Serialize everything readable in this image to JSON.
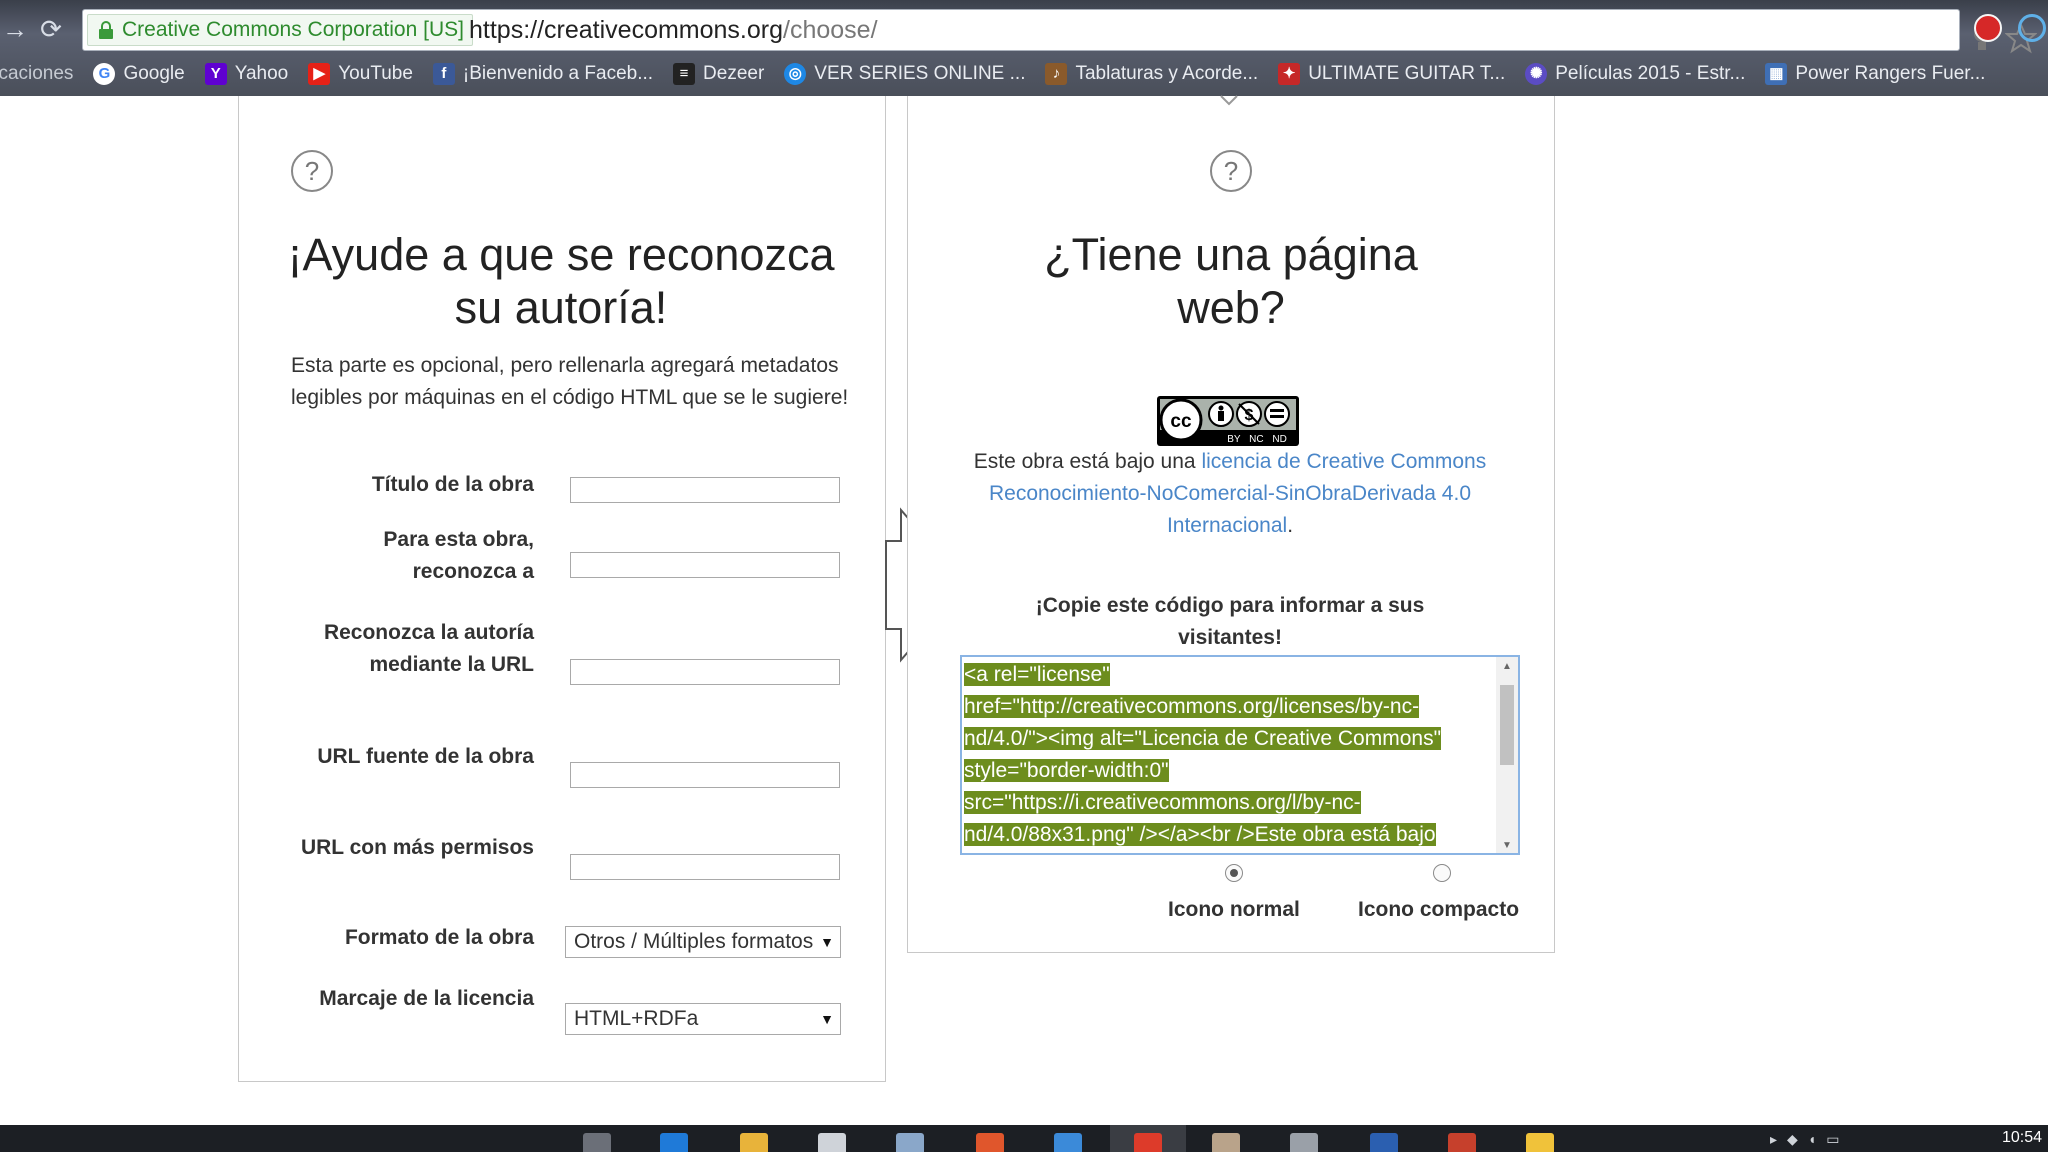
{
  "browser": {
    "secure_label": "Creative Commons Corporation [US]",
    "url_host": "https://creativecommons.org",
    "url_path": "/choose/",
    "bookmarks": [
      {
        "label": "licaciones",
        "icon": "apps-icon"
      },
      {
        "label": "Google",
        "icon": "google-icon"
      },
      {
        "label": "Yahoo",
        "icon": "yahoo-icon"
      },
      {
        "label": "YouTube",
        "icon": "youtube-icon"
      },
      {
        "label": "¡Bienvenido a Faceb...",
        "icon": "facebook-icon"
      },
      {
        "label": "Dezeer",
        "icon": "deezer-icon"
      },
      {
        "label": "VER SERIES ONLINE ...",
        "icon": "series-icon"
      },
      {
        "label": "Tablaturas y Acorde...",
        "icon": "guitar-tabs-icon"
      },
      {
        "label": "ULTIMATE GUITAR T...",
        "icon": "ultimate-guitar-icon"
      },
      {
        "label": "Películas 2015 - Estr...",
        "icon": "movies-icon"
      },
      {
        "label": "Power Rangers Fuer...",
        "icon": "power-rangers-icon"
      }
    ]
  },
  "left_panel": {
    "help_symbol": "?",
    "title": "¡Ayude a que se reconozca su autoría!",
    "description": "Esta parte es opcional, pero rellenarla agregará metadatos legibles por máquinas en el código HTML que se le sugiere!",
    "fields": {
      "title_label": "Título de la obra",
      "attribute_to_label": "Para esta obra, reconozca a",
      "attribution_url_label": "Reconozca la autoría mediante la URL",
      "source_url_label": "URL fuente de la obra",
      "more_permissions_label": "URL con más permisos",
      "format_label": "Formato de la obra",
      "format_value": "Otros / Múltiples formatos",
      "markup_label": "Marcaje de la licencia",
      "markup_value": "HTML+RDFa"
    }
  },
  "right_panel": {
    "help_symbol": "?",
    "title": "¿Tiene una página web?",
    "badge_text": "BY NC ND",
    "license_prefix": "Este obra está bajo una ",
    "license_link": "licencia de Creative Commons Reconocimiento-NoComercial-SinObraDerivada 4.0 Internacional",
    "license_suffix": ".",
    "copy_heading": "¡Copie este código para informar a sus visitantes!",
    "code_lines": [
      "<a rel=\"license\"",
      "href=\"http://creativecommons.org/licenses/by-nc-",
      "nd/4.0/\"><img alt=\"Licencia de Creative Commons\"",
      "style=\"border-width:0\"",
      "src=\"https://i.creativecommons.org/l/by-nc-",
      "nd/4.0/88x31.png\" /></a><br />Este obra está bajo"
    ],
    "icon_normal_label": "Icono normal",
    "icon_compact_label": "Icono compacto",
    "selected_icon": "normal"
  },
  "taskbar": {
    "clock": "10:54"
  }
}
